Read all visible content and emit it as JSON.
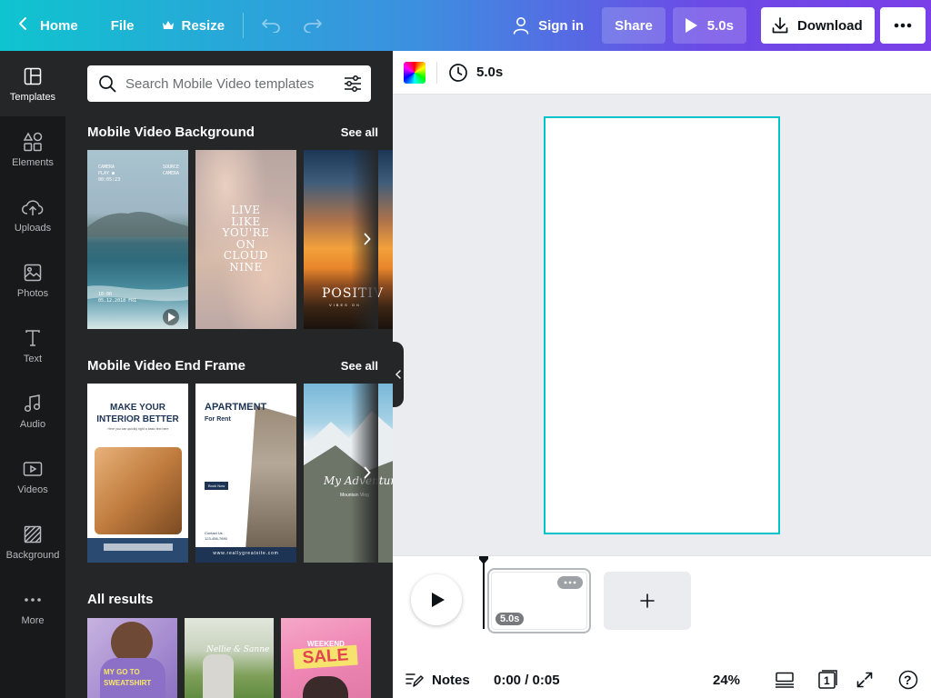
{
  "topbar": {
    "home": "Home",
    "file": "File",
    "resize": "Resize",
    "sign_in": "Sign in",
    "share": "Share",
    "play_duration": "5.0s",
    "download": "Download"
  },
  "rail": {
    "items": [
      {
        "label": "Templates",
        "icon": "templates-icon"
      },
      {
        "label": "Elements",
        "icon": "elements-icon"
      },
      {
        "label": "Uploads",
        "icon": "upload-icon"
      },
      {
        "label": "Photos",
        "icon": "photo-icon"
      },
      {
        "label": "Text",
        "icon": "text-icon"
      },
      {
        "label": "Audio",
        "icon": "music-icon"
      },
      {
        "label": "Videos",
        "icon": "video-icon"
      },
      {
        "label": "Background",
        "icon": "background-icon"
      },
      {
        "label": "More",
        "icon": "more-icon"
      }
    ]
  },
  "panel": {
    "search_placeholder": "Search Mobile Video templates",
    "section1": {
      "title": "Mobile Video Background",
      "see_all": "See all"
    },
    "section2": {
      "title": "Mobile Video End Frame",
      "see_all": "See all"
    },
    "section3": {
      "title": "All results"
    },
    "thumbs1": [
      {
        "top_left": "CAMERA\nPLAY ●\n00:05:23",
        "top_right": "SOURCE\nCAMERA",
        "bottom_text": "10:00\n05.12.2018 FRI"
      },
      {
        "text": "LIVE\nLIKE\nYOU'RE\nON\nCLOUD\nNINE"
      },
      {
        "text": "POSITIV",
        "sub": "VIBES ON"
      }
    ],
    "thumbs2": [
      {
        "title": "MAKE YOUR\nINTERIOR BETTER",
        "sub": "Here you can quickly right a basic text here"
      },
      {
        "title": "APARTMENT",
        "sub": "For Rent",
        "button": "Book Now",
        "contact": "Contact Us\n123-456-7890",
        "url": "www.reallygreatsite.com"
      },
      {
        "title": "My Adventure",
        "sub": "Mountain Vlog"
      }
    ],
    "thumbs3": [
      {
        "text": "MY GO TO\nSWEATSHIRT"
      },
      {
        "text": "Nellie & Sanne"
      },
      {
        "top": "WEEKEND",
        "text": "SALE"
      }
    ]
  },
  "canvas": {
    "duration": "5.0s"
  },
  "timeline": {
    "page_duration": "5.0s",
    "notes": "Notes",
    "time": "0:00 / 0:05",
    "zoom": "24%",
    "page_count": "1",
    "help": "?"
  },
  "colors": {
    "accent": "#00c4cc",
    "rail_bg": "#18191b",
    "panel_bg": "#252627"
  }
}
